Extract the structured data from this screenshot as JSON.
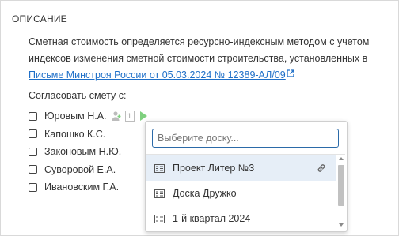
{
  "section": {
    "title": "ОПИСАНИЕ"
  },
  "description": {
    "text": "Сметная стоимость определяется ресурсно-индексным методом с учетом индексов изменения сметной стоимости строительства, установленных в",
    "link_text": "Письме Минстроя России от 05.03.2024 № 12389-АЛ/09"
  },
  "approve": {
    "label": "Согласовать смету с:",
    "people": [
      {
        "name": "Юровым Н.А.",
        "checked": false
      },
      {
        "name": "Капошко К.С.",
        "checked": false
      },
      {
        "name": "Законовым Н.Ю.",
        "checked": false
      },
      {
        "name": "Суворовой Е.А.",
        "checked": false
      },
      {
        "name": "Ивановским Г.А.",
        "checked": false
      }
    ],
    "row_tools": {
      "add_user_icon": "add-user-icon",
      "board_badge": "1",
      "play_icon": "play-icon"
    }
  },
  "board_picker": {
    "placeholder": "Выберите доску...",
    "boards": [
      {
        "label": "Проект Литер №3",
        "selected": true
      },
      {
        "label": "Доска Дружко",
        "selected": false
      },
      {
        "label": "1-й квартал 2024",
        "selected": false
      }
    ]
  },
  "colors": {
    "link": "#1e6fc8",
    "input_border": "#2b6aa8",
    "selected_row": "#e6eef7",
    "play": "#7fd07f"
  }
}
